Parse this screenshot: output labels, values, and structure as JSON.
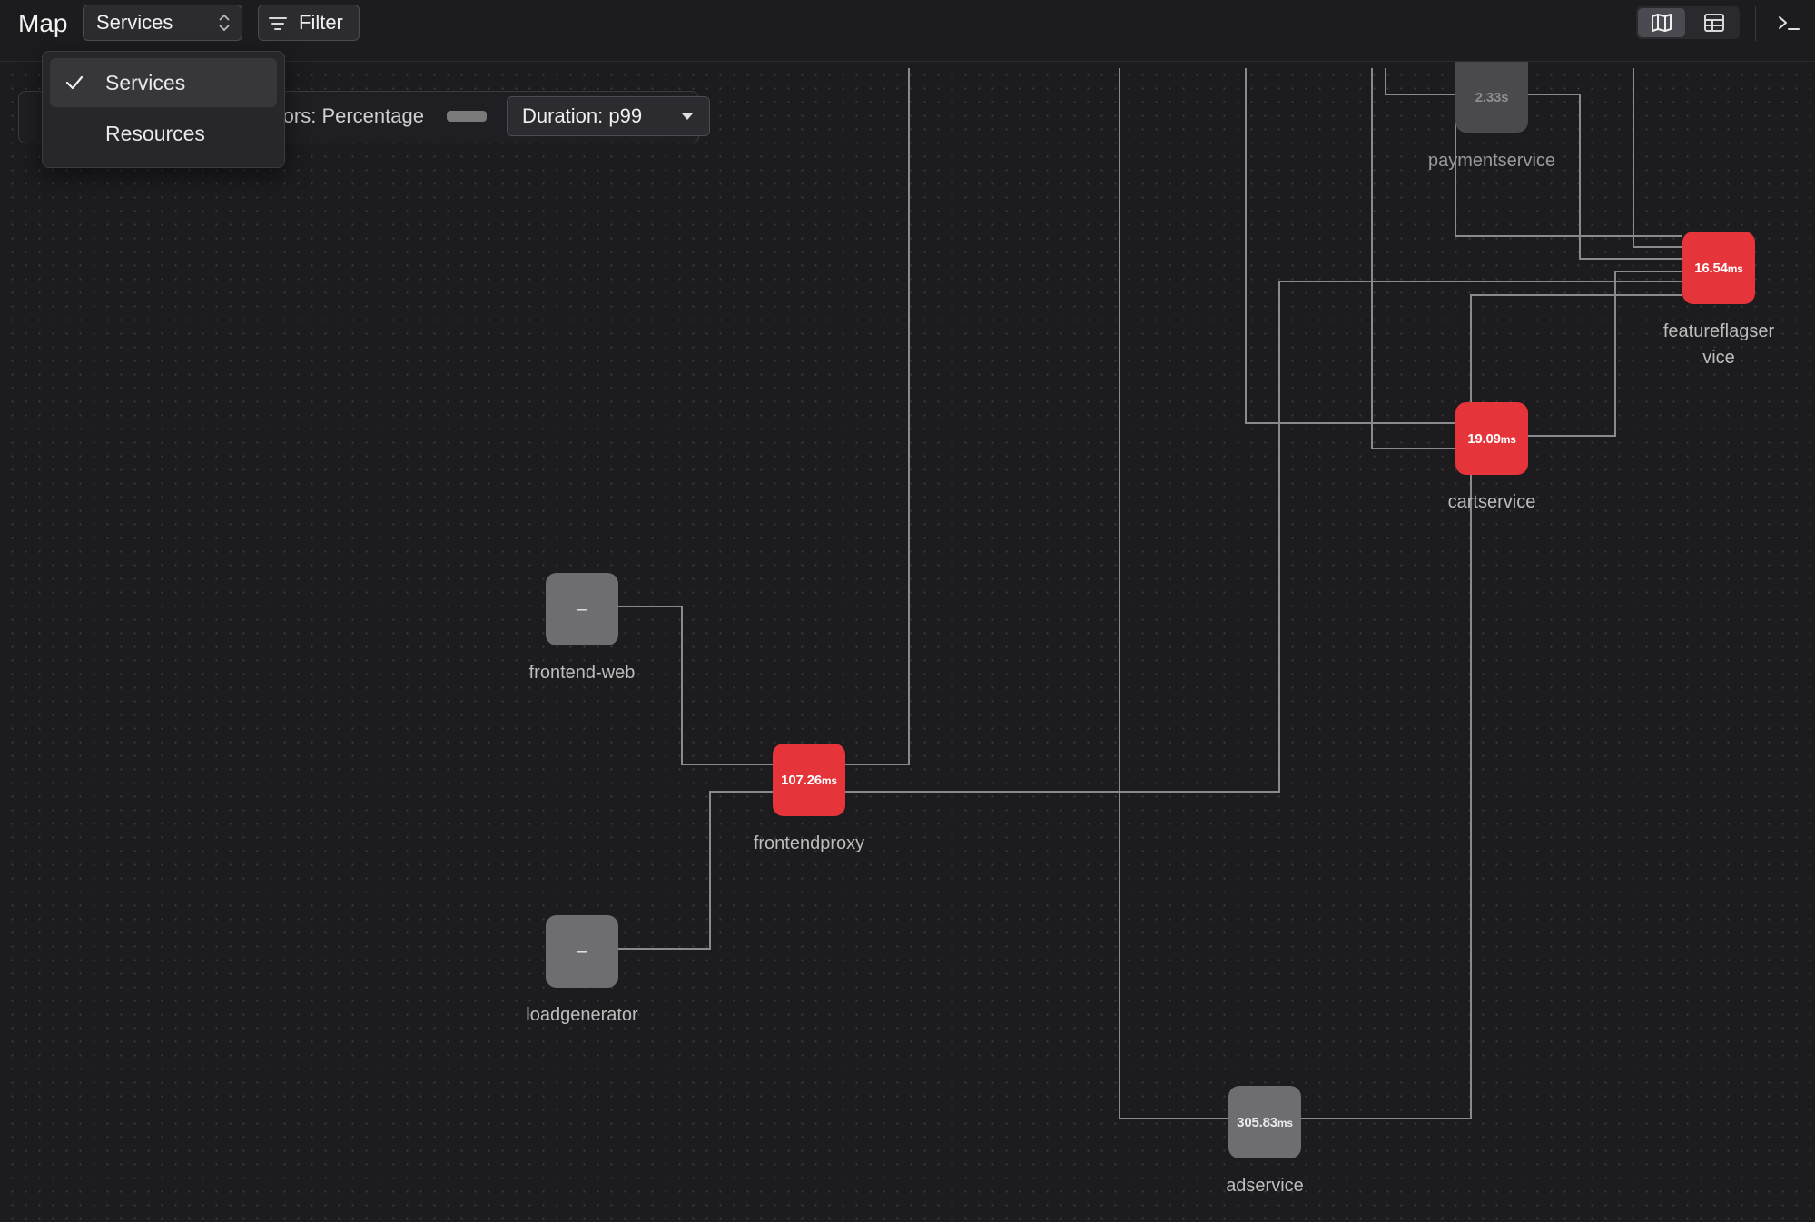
{
  "header": {
    "title": "Map",
    "view_select": "Services",
    "filter_label": "Filter"
  },
  "view_dropdown": {
    "options": [
      {
        "label": "Services",
        "selected": true
      },
      {
        "label": "Resources",
        "selected": false
      }
    ]
  },
  "legend": {
    "errors_label": "rrors: Percentage",
    "duration_label": "Duration: p99"
  },
  "nodes": {
    "paymentservice": {
      "name": "paymentservice",
      "value": "2.33s",
      "status": "faded"
    },
    "featureflagservice": {
      "name": "featureflagservice",
      "name_line1": "featureflagser",
      "name_line2": "vice",
      "value_num": "16.54",
      "value_unit": "ms",
      "status": "error"
    },
    "cartservice": {
      "name": "cartservice",
      "value_num": "19.09",
      "value_unit": "ms",
      "status": "error"
    },
    "frontend_web": {
      "name": "frontend-web",
      "value": "–",
      "status": "no-data"
    },
    "frontendproxy": {
      "name": "frontendproxy",
      "value_num": "107.26",
      "value_unit": "ms",
      "status": "error"
    },
    "loadgenerator": {
      "name": "loadgenerator",
      "value": "–",
      "status": "no-data"
    },
    "adservice": {
      "name": "adservice",
      "value_num": "305.83",
      "value_unit": "ms",
      "status": "ok"
    }
  },
  "colors": {
    "background": "#1c1c1f",
    "error_node": "#e5343a",
    "neutral_node": "#6e6e72",
    "edge": "#8a8a8e"
  },
  "icons": [
    "check-icon",
    "chevron-updown-icon",
    "filter-icon",
    "map-view-icon",
    "table-view-icon",
    "terminal-icon",
    "caret-down-icon"
  ]
}
